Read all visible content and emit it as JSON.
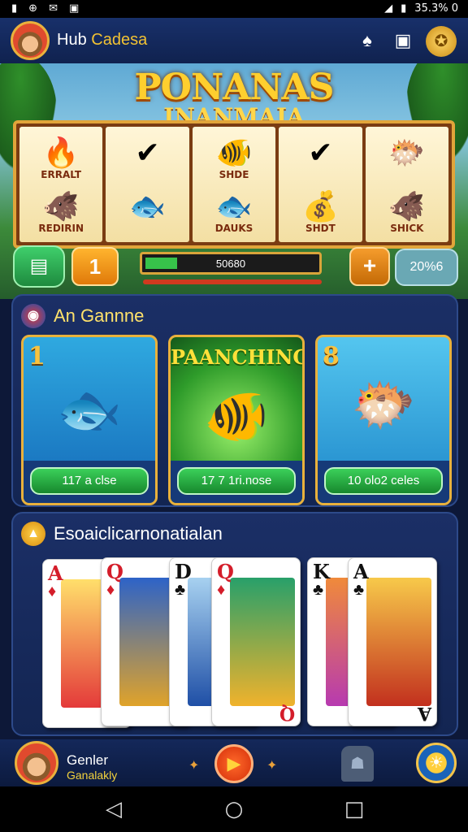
{
  "status_bar": {
    "left_icons": [
      "sim-icon",
      "globe-icon",
      "message-icon",
      "notification-icon"
    ],
    "right_text": "35.3% 0"
  },
  "header": {
    "title_part1": "Hub ",
    "title_part2": "Cadesa",
    "icons": [
      "spade-icon",
      "camera-icon",
      "gold-coin-icon"
    ]
  },
  "banner": {
    "logo_line1": "PONANAS",
    "logo_line2": "INANMAIA"
  },
  "reels": [
    [
      {
        "glyph": "🔥",
        "label": "ERRALT"
      },
      {
        "glyph": "🐗",
        "label": "REDIRIN"
      }
    ],
    [
      {
        "glyph": "✔",
        "label": ""
      },
      {
        "glyph": "🐟",
        "label": ""
      }
    ],
    [
      {
        "glyph": "🐠",
        "label": "SHDE"
      },
      {
        "glyph": "🐟",
        "label": "DAUKS"
      }
    ],
    [
      {
        "glyph": "✔",
        "label": ""
      },
      {
        "glyph": "💰",
        "label": "SHDT"
      }
    ],
    [
      {
        "glyph": "🐡",
        "label": ""
      },
      {
        "glyph": "🐗",
        "label": "SHICK"
      }
    ]
  ],
  "controls": {
    "bet_level": "1",
    "meter_value": "50680",
    "meter_fraction": 0.18,
    "plus_label": "+",
    "score": "20%6"
  },
  "games_section": {
    "title": "An Gannne",
    "cards": [
      {
        "number": "1",
        "headline": "",
        "cta": "117 a clse",
        "theme": "blue-marlin"
      },
      {
        "number": "",
        "headline": "PAANCHING",
        "cta": "17 7 1ri.nose",
        "theme": "green-fish"
      },
      {
        "number": "8",
        "headline": "",
        "cta": "10 olo2 celes",
        "theme": "treasure-fish"
      }
    ]
  },
  "cards_section": {
    "title": "Esoaiclicarnonatialan",
    "cards": [
      {
        "rank": "A",
        "suit": "♦",
        "color": "red"
      },
      {
        "rank": "Q",
        "suit": "♦",
        "color": "red"
      },
      {
        "rank": "D",
        "suit": "♣",
        "color": "black"
      },
      {
        "rank": "Q",
        "suit": "♦",
        "color": "red"
      },
      {
        "rank": "K",
        "suit": "♣",
        "color": "black"
      },
      {
        "rank": "A",
        "suit": "♣",
        "color": "black"
      }
    ]
  },
  "bottom_bar": {
    "player_name": "Genler",
    "player_sub": "Ganalakly"
  },
  "nav": {
    "back": "◁",
    "home": "○",
    "recents": "□"
  },
  "colors": {
    "accent_gold": "#e9b13c",
    "panel_blue": "#1b2f66",
    "cta_green": "#17882d"
  }
}
